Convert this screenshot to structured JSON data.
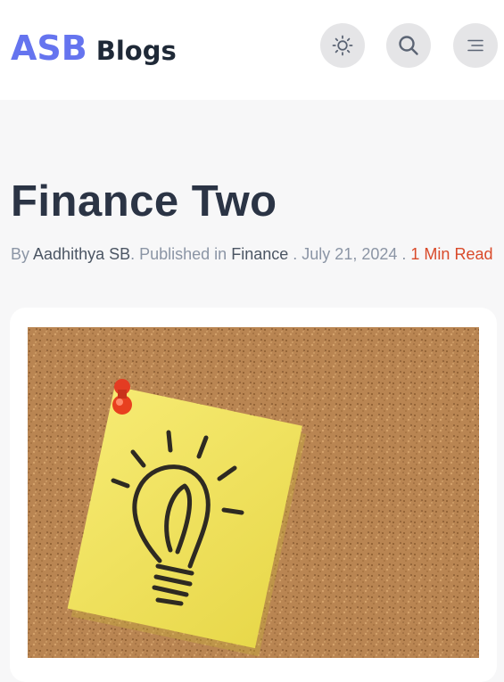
{
  "header": {
    "logo_primary": "ASB",
    "logo_secondary": "Blogs",
    "buttons": [
      {
        "name": "theme-toggle",
        "icon": "sun-icon"
      },
      {
        "name": "search",
        "icon": "search-icon"
      },
      {
        "name": "menu",
        "icon": "menu-icon"
      }
    ]
  },
  "post": {
    "title": "Finance Two",
    "by_label": "By",
    "author": "Aadhithya SB",
    "published_label": ". Published in",
    "category": "Finance",
    "separator_1": ".",
    "date": "July 21, 2024",
    "separator_2": ".",
    "read_time": "1 Min Read"
  },
  "colors": {
    "brand": "#6574ef",
    "read_time": "#d94a2a",
    "background": "#f7f7f8"
  },
  "featured_image": {
    "description_icon": "lightbulb-sticky-note-on-corkboard"
  }
}
